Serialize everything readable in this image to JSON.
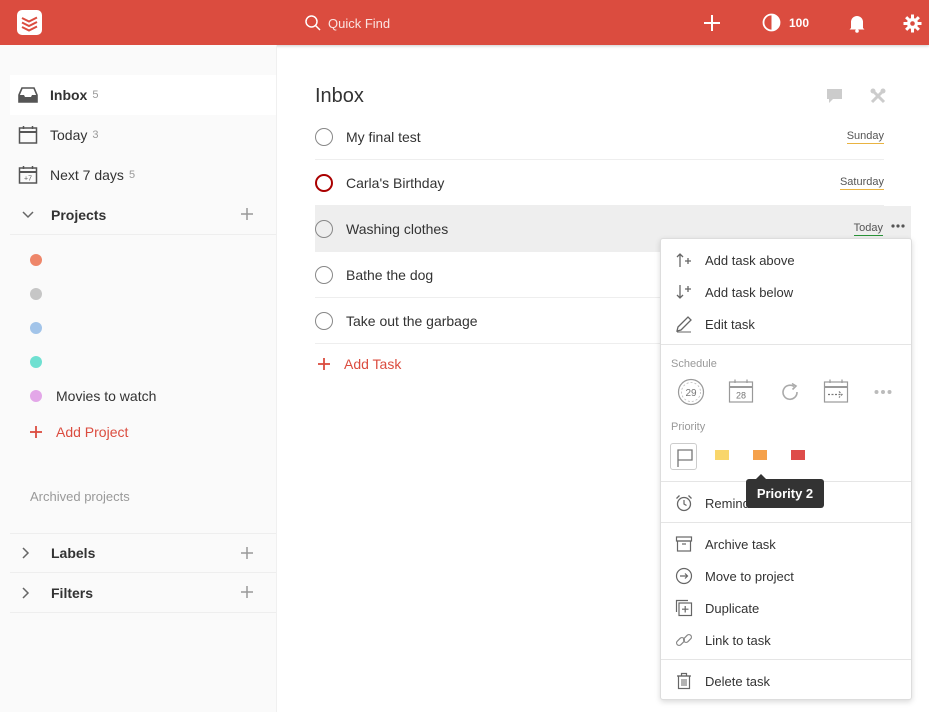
{
  "topbar": {
    "logo_icon": "todoist-logo-icon",
    "search_placeholder": "Quick Find",
    "karma_value": "100",
    "icons": [
      "plus-icon",
      "karma-icon",
      "bell-icon",
      "gear-icon"
    ],
    "color": "#db4c3f"
  },
  "sidebar": {
    "nav": [
      {
        "label": "Inbox",
        "count": "5",
        "icon": "inbox-icon"
      },
      {
        "label": "Today",
        "count": "3",
        "icon": "calendar-today-icon"
      },
      {
        "label": "Next 7 days",
        "count": "5",
        "icon": "calendar-week-icon"
      }
    ],
    "projects_label": "Projects",
    "projects": [
      {
        "label": "",
        "color": "#ee8669"
      },
      {
        "label": "",
        "color": "#c6c6c6"
      },
      {
        "label": "",
        "color": "#a2c4e9"
      },
      {
        "label": "",
        "color": "#6fe0d1"
      },
      {
        "label": "Movies to watch",
        "color": "#e3a7e8"
      }
    ],
    "add_project": "Add Project",
    "archived": "Archived projects",
    "labels_label": "Labels",
    "filters_label": "Filters"
  },
  "main": {
    "title": "Inbox",
    "tasks": [
      {
        "name": "My final test",
        "date": "Sunday",
        "priority": "none"
      },
      {
        "name": "Carla's Birthday",
        "date": "Saturday",
        "priority": "p1"
      },
      {
        "name": "Washing clothes",
        "date": "Today",
        "priority": "none"
      },
      {
        "name": "Bathe the dog",
        "date": "",
        "priority": "none"
      },
      {
        "name": "Take out the garbage",
        "date": "",
        "priority": "none"
      }
    ],
    "add_task": "Add Task"
  },
  "menu": {
    "add_above": "Add task above",
    "add_below": "Add task below",
    "edit": "Edit task",
    "schedule_label": "Schedule",
    "today_day": "29",
    "tomorrow_day": "28",
    "priority_label": "Priority",
    "priority_colors": {
      "p4": "#888888",
      "p3": "#f9d66b",
      "p2": "#f5a14b",
      "p1": "#de4c4a"
    },
    "reminders": "Reminders",
    "archive": "Archive task",
    "move": "Move to project",
    "duplicate": "Duplicate",
    "link": "Link to task",
    "delete": "Delete task"
  },
  "tooltip": "Priority 2"
}
